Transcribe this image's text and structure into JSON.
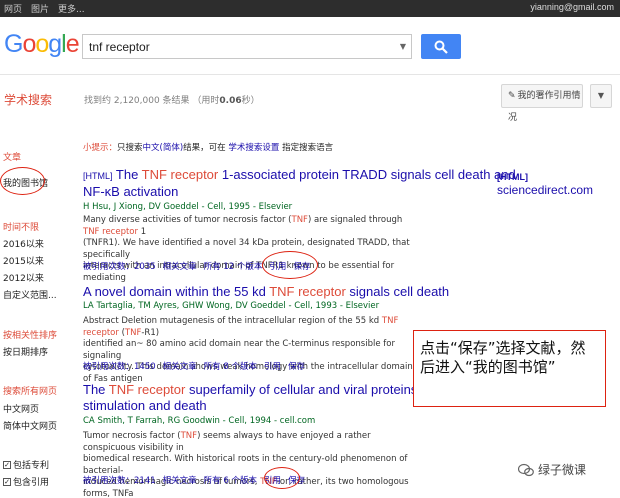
{
  "topbar": {
    "nav": [
      "网页",
      "图片",
      "更多..."
    ],
    "email": "yianning@gmail.com"
  },
  "logo": {
    "letters": [
      "G",
      "o",
      "o",
      "g",
      "l",
      "e"
    ],
    "colors": [
      "#4285f4",
      "#ea4335",
      "#fbbc05",
      "#4285f4",
      "#34a853",
      "#ea4335"
    ]
  },
  "search": {
    "query": "tnf receptor",
    "button_icon": "search-icon"
  },
  "header": {
    "scholar_label": "学术搜索",
    "stats_prefix": "找到约 ",
    "stats_count": "2,120,000",
    "stats_suffix": " 条结果 （用时",
    "stats_time": "0.06",
    "stats_end": "秒）",
    "my_citations": "我的署作引用情况",
    "menu_icon": "caret-down-icon"
  },
  "sidebar": {
    "articles": "文章",
    "my_library": "我的图书馆",
    "time_any": "时间不限",
    "since_2016": "2016以来",
    "since_2015": "2015以来",
    "since_2012": "2012以来",
    "custom_range": "自定义范围...",
    "sort_relevance": "按相关性排序",
    "sort_date": "按日期排序",
    "lang_all": "搜索所有网页",
    "lang_chinese": "中文网页",
    "lang_simplified": "简体中文网页",
    "include_patents": "包括专利",
    "include_citations": "包含引用"
  },
  "tip": {
    "label": "小提示：",
    "text1": "只搜索",
    "link": "中文(简体)",
    "text2": "结果，可在 ",
    "link2": "学术搜索设置",
    "text3": " 指定搜索语言"
  },
  "results": [
    {
      "tag": "[HTML]",
      "title_pre": " The ",
      "title_hl": "TNF receptor",
      "title_post1": " 1-associated protein TRADD signals cell death and",
      "title_post2": "NF-κB activation",
      "authors": "H Hsu, J Xiong, DV Goeddel - Cell, 1995 - Elsevier",
      "snippet": [
        [
          "Many diverse activities of tumor necrosis factor (",
          "TNF",
          ") are signaled through ",
          "TNF receptor",
          " 1"
        ],
        [
          "(TNFR1). We have identified a novel 34 kDa protein, designated TRADD, that specifically",
          "",
          "",
          "",
          ""
        ],
        [
          "interacts with an intracellular domain of TNFR1 known to be essential for mediating",
          "",
          "",
          "",
          ""
        ]
      ],
      "links": [
        "被引用次数：2035",
        "相关文章",
        "所有 12 个版本",
        "引用",
        "保存"
      ]
    },
    {
      "title_pre": "A novel domain within the 55 kd ",
      "title_hl": "TNF receptor",
      "title_post1": " signals cell death",
      "authors": "LA Tartaglia, TM Ayres, GHW Wong, DV Goeddel - Cell, 1993 - Elsevier",
      "snippet": [
        [
          "Abstract Deletion mutagenesis of the intracellular region of the 55 kd ",
          "TNF receptor",
          " (",
          "TNF",
          "-R1)"
        ],
        [
          "identified an~ 80 amino acid domain near the C-terminus responsible for signaling",
          "",
          "",
          "",
          ""
        ],
        [
          "cytotoxicity. This domain shows weak homology with the intracellular domain of Fas antigen",
          "",
          "",
          "",
          ""
        ]
      ],
      "links": [
        "被引用次数：1450",
        "相关文章",
        "所有 8 个版本",
        "引用",
        "保存"
      ]
    },
    {
      "title_pre": "The ",
      "title_hl": "TNF receptor",
      "title_post1": " superfamily of cellular and viral proteins: activation, co",
      "title_post2": "stimulation and death",
      "authors": "CA Smith, T Farrah, RG Goodwin - Cell, 1994 - cell.com",
      "snippet": [
        [
          "Tumor necrosis factor (",
          "TNF",
          ") seems always to have enjoyed a rather conspicuous visibility in",
          "",
          ""
        ],
        [
          "biomedical research. With historical roots in the century-old phenomenon of bacterial-",
          "",
          "",
          "",
          ""
        ],
        [
          "induced hemorrhagic necrosis of tumors, ",
          "TNF",
          "-or, rather, its two homologous forms, TNFa",
          "",
          ""
        ]
      ],
      "links": [
        "被引用次数：2141",
        "相关文章",
        "所有 6 个版本",
        "引用",
        "保存"
      ]
    }
  ],
  "side_link": {
    "tag": "[HTML]",
    "site": " sciencedirect.com"
  },
  "annotation": "点击“保存”选择文献，然后进入“我的图书馆”",
  "watermark": {
    "text": "绿子微课",
    "icon": "wechat-icon"
  },
  "colors": {
    "link": "#1a0dab",
    "highlight": "#dd4b39",
    "author": "#006621",
    "annotation_border": "#dd2211"
  }
}
